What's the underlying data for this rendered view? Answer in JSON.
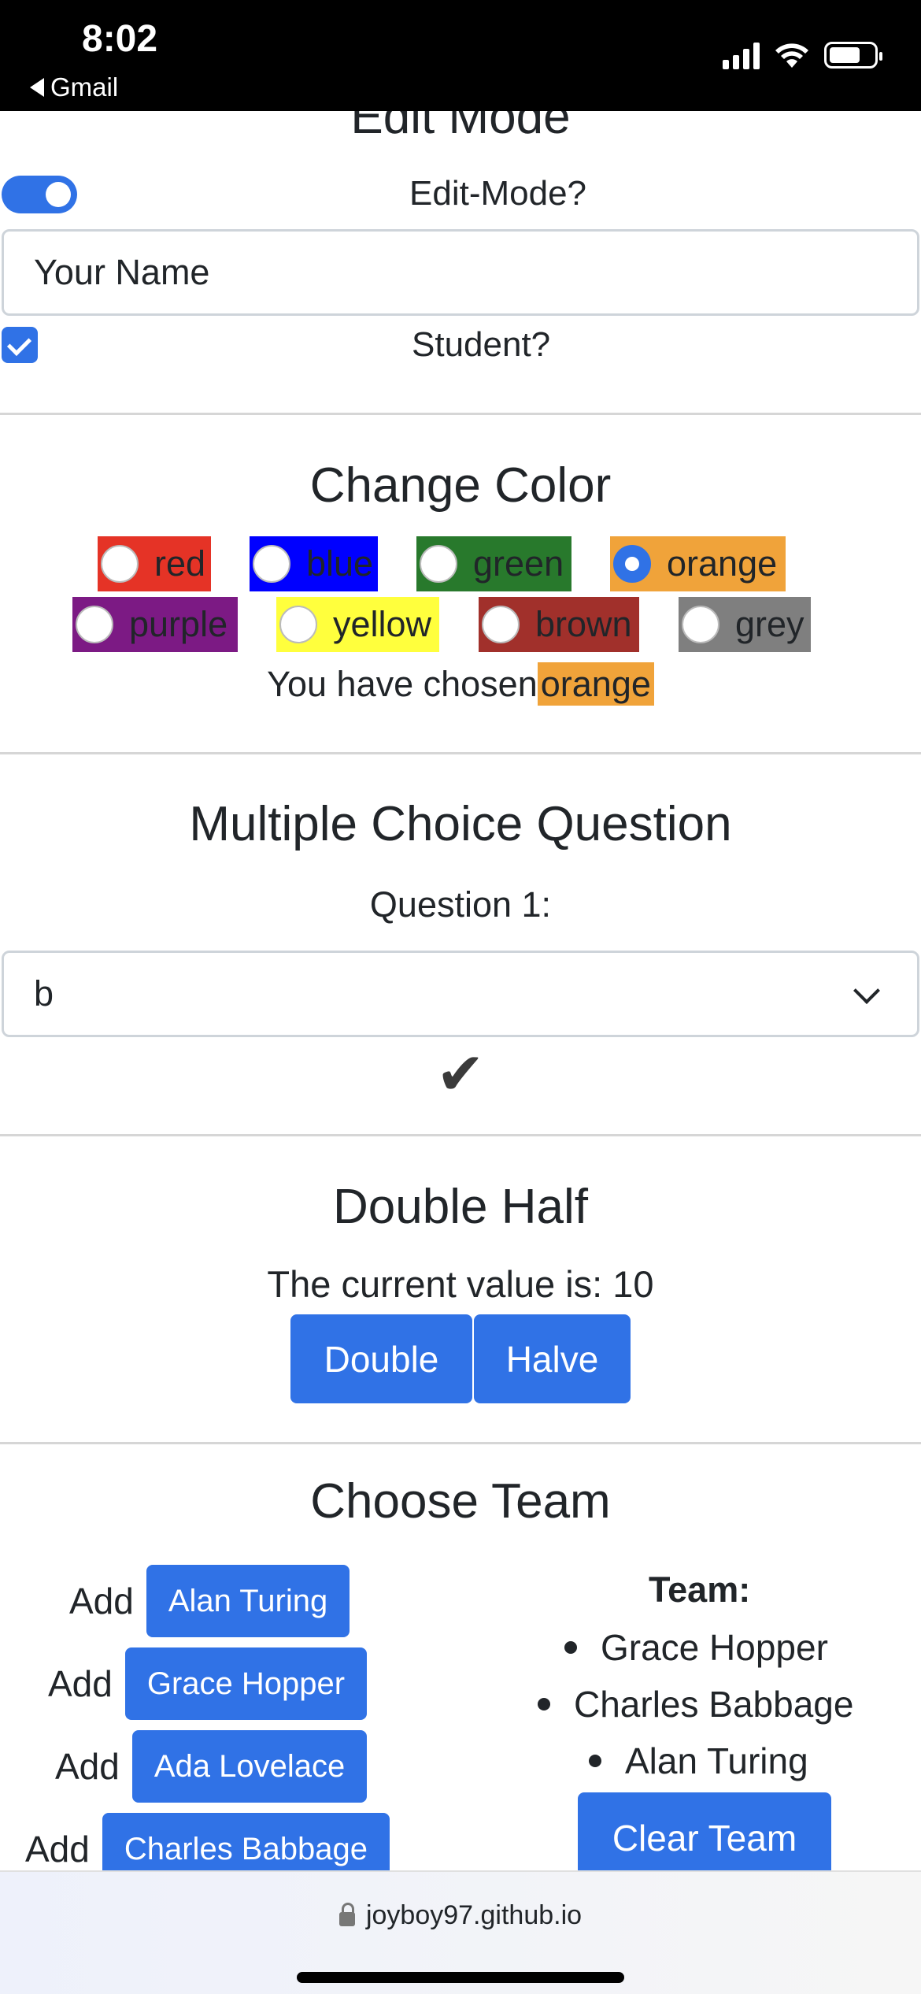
{
  "status_bar": {
    "time": "8:02",
    "back_app": "Gmail"
  },
  "edit_section": {
    "title": "Edit Mode",
    "toggle_label": "Edit-Mode?",
    "toggle_on": true,
    "name_value": "Your Name",
    "student_label": "Student?",
    "student_checked": true
  },
  "color_section": {
    "title": "Change Color",
    "options": [
      {
        "label": "red",
        "bg": "#e53326",
        "selected": false
      },
      {
        "label": "blue",
        "bg": "#0000ff",
        "selected": false
      },
      {
        "label": "green",
        "bg": "#28792c",
        "selected": false
      },
      {
        "label": "orange",
        "bg": "#f0a33a",
        "selected": true
      },
      {
        "label": "purple",
        "bg": "#7c1a84",
        "selected": false
      },
      {
        "label": "yellow",
        "bg": "#ffff3d",
        "selected": false
      },
      {
        "label": "brown",
        "bg": "#a1302b",
        "selected": false
      },
      {
        "label": "grey",
        "bg": "#7f7f7f",
        "selected": false
      }
    ],
    "chosen_prefix": "You have chosen",
    "chosen_value": "orange"
  },
  "mcq_section": {
    "title": "Multiple Choice Question",
    "question_label": "Question 1:",
    "selected_answer": "b",
    "result_mark": "✔"
  },
  "double_half_section": {
    "title": "Double Half",
    "value_text": "The current value is: 10",
    "double_label": "Double",
    "halve_label": "Halve"
  },
  "team_section": {
    "title": "Choose Team",
    "add_word": "Add",
    "people": [
      "Alan Turing",
      "Grace Hopper",
      "Ada Lovelace",
      "Charles Babbage"
    ],
    "team_heading": "Team:",
    "team_members": [
      "Grace Hopper",
      "Charles Babbage",
      "Alan Turing"
    ],
    "clear_label": "Clear Team"
  },
  "browser": {
    "url": "joyboy97.github.io"
  },
  "colors": {
    "accent": "#3072e6",
    "divider": "#d6d6d6"
  }
}
